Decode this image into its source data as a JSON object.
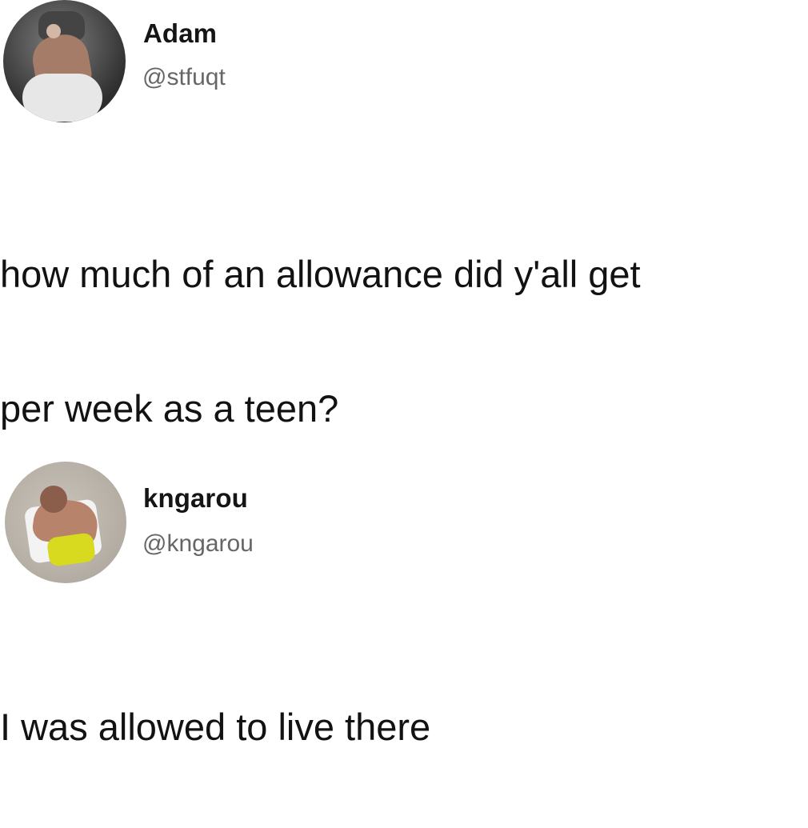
{
  "posts": [
    {
      "name": "Adam",
      "handle": "@stfuqt",
      "text_lines": [
        "how much of an allowance did y'all get",
        "per week as a teen?"
      ]
    },
    {
      "name": "kngarou",
      "handle": "@kngarou",
      "text_lines": [
        "I was allowed to live there"
      ]
    }
  ]
}
